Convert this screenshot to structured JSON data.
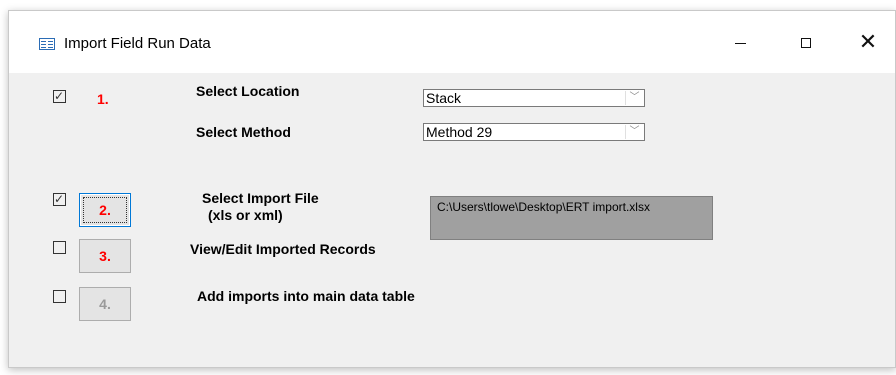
{
  "window": {
    "title": "Import Field Run Data",
    "controls": {
      "minimize": "—",
      "maximize": "☐",
      "close": "✕"
    }
  },
  "step1": {
    "checked": true,
    "label": "1.",
    "location_label": "Select Location",
    "location_value": "Stack",
    "method_label": "Select Method",
    "method_value": "Method 29"
  },
  "step2": {
    "checked": true,
    "button_label": "2.",
    "label_line1": "Select Import File",
    "label_line2": "(xls or xml)",
    "file_path": "C:\\Users\\tlowe\\Desktop\\ERT import.xlsx"
  },
  "step3": {
    "checked": false,
    "button_label": "3.",
    "label": "View/Edit Imported Records"
  },
  "step4": {
    "checked": false,
    "button_label": "4.",
    "label": "Add imports into main data table"
  },
  "colors": {
    "step_number": "#ff0000",
    "disabled_number": "#9a9a9a",
    "file_box": "#a0a0a0"
  },
  "icons": {
    "app": "form-icon",
    "check": "checkmark-icon",
    "dropdown": "chevron-down-icon"
  }
}
